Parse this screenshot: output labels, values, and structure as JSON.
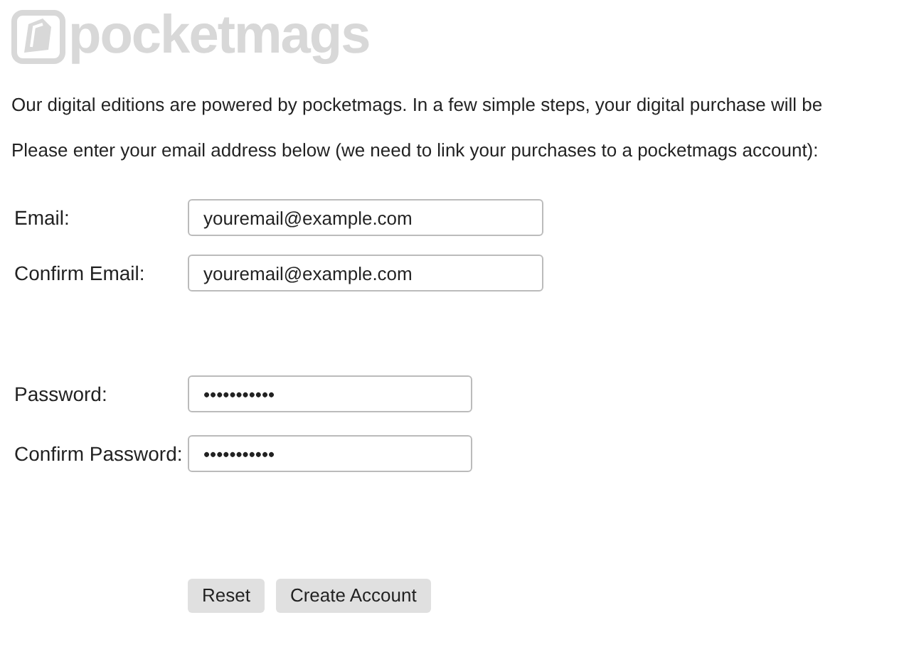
{
  "logo": {
    "text": "pocketmags"
  },
  "intro": [
    "Our digital editions are powered by pocketmags. In a few simple steps, your digital purchase will be",
    "Please enter your email address below (we need to link your purchases to a pocketmags account):"
  ],
  "email_fields": [
    {
      "label": "Email:",
      "value": "youremail@example.com"
    },
    {
      "label": "Confirm Email:",
      "value": "youremail@example.com"
    }
  ],
  "password_fields": [
    {
      "label": "Password:",
      "value": "•••••••••••"
    },
    {
      "label": "Confirm Password:",
      "value": "•••••••••••"
    }
  ],
  "buttons": [
    "Reset",
    "Create Account"
  ]
}
